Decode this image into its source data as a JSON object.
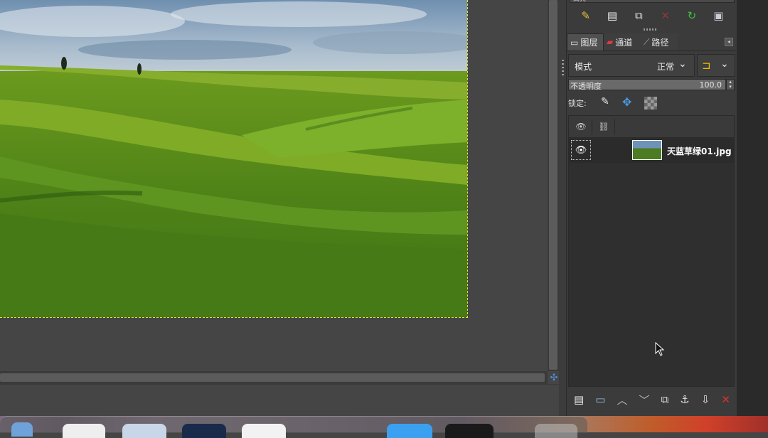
{
  "canvas": {
    "selection_color": "#e6e62a"
  },
  "dock": {
    "top_select_label": "高亮",
    "toolbar": {
      "icons": [
        "edit-layer-icon",
        "new-image-icon",
        "duplicate-icon",
        "delete-icon",
        "refresh-icon",
        "save-icon"
      ]
    },
    "tabs": [
      {
        "label": "图层",
        "icon": "layers-icon"
      },
      {
        "label": "通道",
        "icon": "channels-icon"
      },
      {
        "label": "路径",
        "icon": "paths-icon"
      }
    ],
    "mode": {
      "label": "模式",
      "value": "正常"
    },
    "opacity": {
      "label": "不透明度",
      "value": "100.0",
      "percent": 100
    },
    "lock": {
      "label": "锁定:"
    },
    "layers": [
      {
        "name": "天蓝草绿01.jpg",
        "visible": true
      }
    ],
    "bottom_toolbar": {
      "icons": [
        "new-layer-icon",
        "new-layer-group-icon",
        "raise-layer-icon",
        "lower-layer-icon",
        "duplicate-layer-icon",
        "anchor-layer-icon",
        "merge-down-icon",
        "delete-layer-icon"
      ]
    }
  },
  "colors": {
    "panel_bg": "#3b3b3b",
    "canvas_bg": "#454545",
    "accent_blue": "#4a9be8",
    "delete_red": "#d93030",
    "refresh_green": "#3bbf3b"
  }
}
